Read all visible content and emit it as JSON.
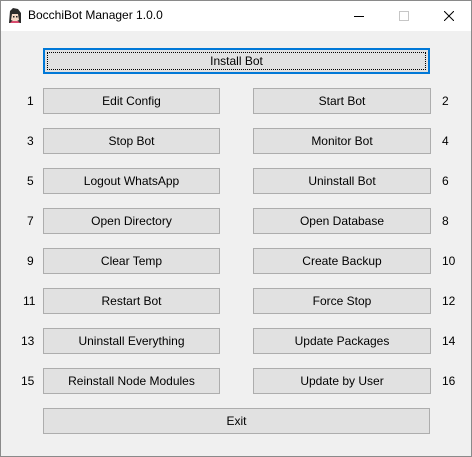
{
  "window": {
    "title": "BocchiBot Manager 1.0.0",
    "icon": "bocchi-app-icon",
    "controls": [
      "minimize",
      "maximize",
      "close"
    ]
  },
  "install_button": "Install Bot",
  "left_numbers": [
    "1",
    "3",
    "5",
    "7",
    "9",
    "11",
    "13",
    "15"
  ],
  "right_numbers": [
    "2",
    "4",
    "6",
    "8",
    "10",
    "12",
    "14",
    "16"
  ],
  "left_buttons": [
    "Edit Config",
    "Stop Bot",
    "Logout WhatsApp",
    "Open Directory",
    "Clear Temp",
    "Restart Bot",
    "Uninstall Everything",
    "Reinstall Node Modules"
  ],
  "right_buttons": [
    "Start Bot",
    "Monitor Bot",
    "Uninstall Bot",
    "Open Database",
    "Create Backup",
    "Force Stop",
    "Update Packages",
    "Update by User"
  ],
  "exit_button": "Exit"
}
